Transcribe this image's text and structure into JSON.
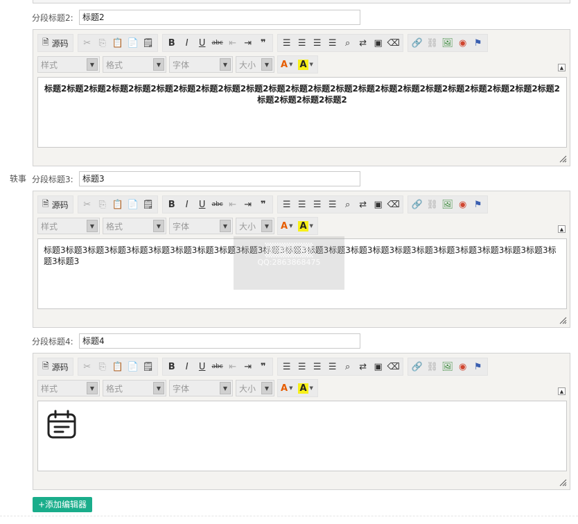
{
  "side_label": "轶事",
  "sections": [
    {
      "label": "分段标题2:",
      "value": "标题2",
      "content": "标题2标题2标题2标题2标题2标题2标题2标题2标题2标题2标题2标题2标题2标题2标题2标题2标题2标题2标题2标题2标题2标题2标题2标题2标题2标题2标题2"
    },
    {
      "label": "分段标题3:",
      "value": "标题3",
      "content": "标题3标题3标题3标题3标题3标题3标题3标题3标题3标题3标题3标题3标题3标题3标题3标题3标题3标题3标题3标题3标题3标题3标题3标题3标题3"
    },
    {
      "label": "分段标题4:",
      "value": "标题4",
      "content": ""
    }
  ],
  "toolbar": {
    "source": "源码",
    "style": "样式",
    "format": "格式",
    "font": "字体",
    "size": "大小",
    "bold": "B",
    "italic": "I",
    "underline": "U",
    "strike": "abc",
    "quote": "❞"
  },
  "add_button": "+添加编辑器",
  "watermark": {
    "line1": "QQ:2863868475"
  }
}
